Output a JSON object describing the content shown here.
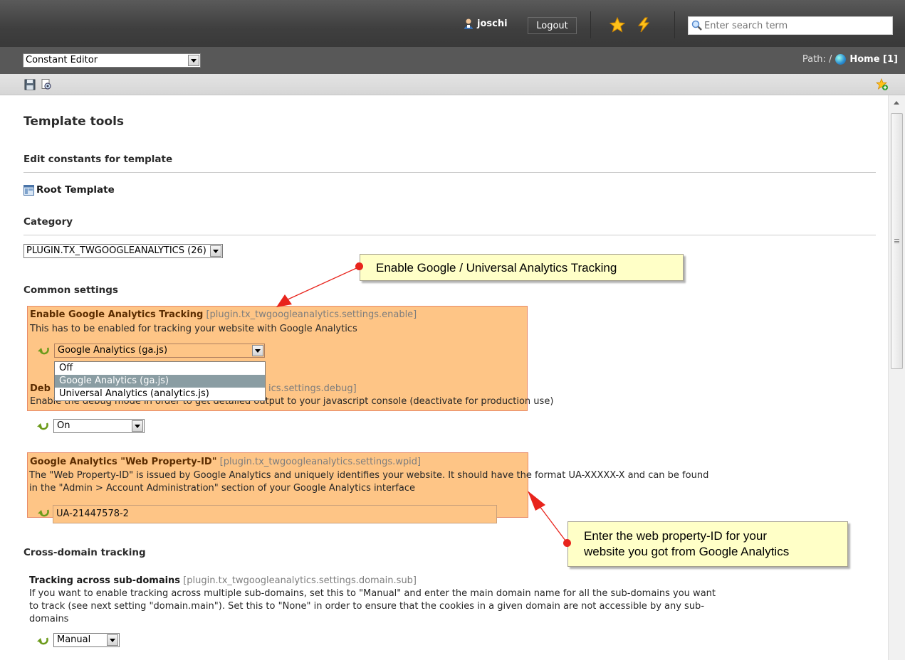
{
  "topbar": {
    "username": "joschi",
    "logout_label": "Logout",
    "search_placeholder": "Enter search term",
    "icons": [
      "user-icon",
      "star-icon",
      "lightning-icon",
      "search-icon"
    ]
  },
  "secbar": {
    "function_select": "Constant Editor",
    "path_label": "Path: /",
    "path_page": "Home [1]"
  },
  "docbar": {
    "icons": [
      "save-icon",
      "view-page-icon",
      "shortcut-star-icon"
    ]
  },
  "content": {
    "page_title": "Template tools",
    "edit_heading": "Edit constants for template",
    "template_name": "Root Template",
    "category_label": "Category",
    "category_value": "PLUGIN.TX_TWGOOGLEANALYTICS (26)",
    "common_heading": "Common settings",
    "enable": {
      "title": "Enable Google Analytics Tracking",
      "key": "[plugin.tx_twgoogleanalytics.settings.enable]",
      "desc": "This has to be enabled for tracking your website with Google Analytics",
      "value": "Google Analytics (ga.js)",
      "options": [
        "Off",
        "Google Analytics (ga.js)",
        "Universal Analytics (analytics.js)"
      ]
    },
    "debug": {
      "title_fragment": "Deb",
      "key_fragment": "ics.settings.debug]",
      "desc": "Enable the debug mode in order to get detailed output to your javascript console (deactivate for production use)",
      "value": "On"
    },
    "wpid": {
      "title": "Google Analytics \"Web Property-ID\"",
      "key": "[plugin.tx_twgoogleanalytics.settings.wpid]",
      "desc_line1": "The \"Web Property-ID\" is issued by Google Analytics and uniquely identifies your website. It should have the format UA-XXXXX-X and can be found",
      "desc_line2": "in the \"Admin > Account Administration\" section of your Google Analytics interface",
      "value": "UA-21447578-2"
    },
    "crossdomain_heading": "Cross-domain tracking",
    "subdomain": {
      "title": "Tracking across sub-domains",
      "key": "[plugin.tx_twgoogleanalytics.settings.domain.sub]",
      "desc_line1": "If you want to enable tracking across multiple sub-domains, set this to \"Manual\" and enter the main domain name for all the sub-domains you want",
      "desc_line2": "to track (see next setting \"domain.main\"). Set this to \"None\" in order to ensure that the cookies in a given domain are not accessible by any sub-",
      "desc_line3": "domains",
      "value": "Manual"
    }
  },
  "callouts": {
    "enable_note": "Enable Google / Universal Analytics Tracking",
    "wpid_note_line1": "Enter the web property-ID for your",
    "wpid_note_line2": "website you got from Google Analytics"
  },
  "colors": {
    "highlight_box": "#fec586",
    "callout_bg": "#ffffc7",
    "arrow": "#e8241c"
  }
}
